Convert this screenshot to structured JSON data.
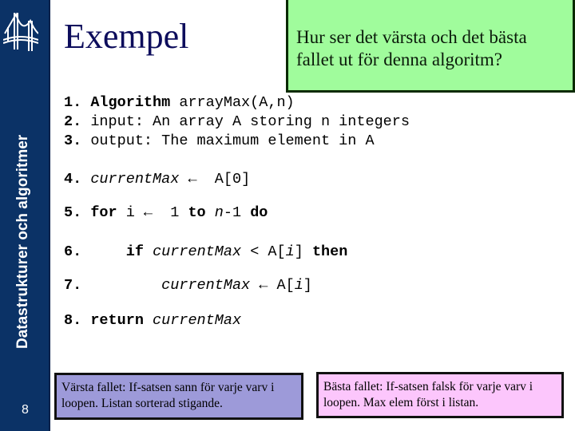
{
  "sidebar": {
    "course_title": "Datastrukturer och algoritmer",
    "logo_icon": "bridge-logo-icon",
    "slide_number": "8",
    "color": "#0b3266"
  },
  "slide": {
    "title": "Exempel",
    "question": "Hur ser det värsta och det bästa fallet ut för denna algoritm?",
    "question_box_color": "#a0fc9c"
  },
  "code": {
    "lines": [
      {
        "num": "1.",
        "parts": [
          {
            "t": "Algorithm",
            "s": "kw"
          },
          {
            "t": " arrayMax(A,n)",
            "s": ""
          }
        ]
      },
      {
        "num": "2.",
        "parts": [
          {
            "t": "input: An array A storing n integers",
            "s": ""
          }
        ]
      },
      {
        "num": "3.",
        "parts": [
          {
            "t": "output: The maximum element in A",
            "s": ""
          }
        ]
      },
      {
        "num": "4.",
        "parts": [
          {
            "t": "currentMax",
            "s": "it"
          },
          {
            "t": " ← ",
            "s": ""
          },
          {
            "t": " A[0]",
            "s": ""
          }
        ]
      },
      {
        "num": "5.",
        "parts": [
          {
            "t": "for",
            "s": "kw"
          },
          {
            "t": " i ← ",
            "s": ""
          },
          {
            "t": " 1 ",
            "s": ""
          },
          {
            "t": "to",
            "s": "kw"
          },
          {
            "t": " ",
            "s": ""
          },
          {
            "t": "n",
            "s": "it"
          },
          {
            "t": "-1 ",
            "s": ""
          },
          {
            "t": "do",
            "s": "kw"
          }
        ]
      },
      {
        "num": "6.",
        "parts": [
          {
            "t": "    ",
            "s": ""
          },
          {
            "t": "if",
            "s": "kw"
          },
          {
            "t": " ",
            "s": ""
          },
          {
            "t": "currentMax",
            "s": "it"
          },
          {
            "t": " < A[",
            "s": ""
          },
          {
            "t": "i",
            "s": "it"
          },
          {
            "t": "] ",
            "s": ""
          },
          {
            "t": "then",
            "s": "kw"
          }
        ]
      },
      {
        "num": "7.",
        "parts": [
          {
            "t": "        ",
            "s": ""
          },
          {
            "t": "currentMax",
            "s": "it"
          },
          {
            "t": " ← A[",
            "s": ""
          },
          {
            "t": "i",
            "s": "it"
          },
          {
            "t": "]",
            "s": ""
          }
        ]
      },
      {
        "num": "8.",
        "parts": [
          {
            "t": "return",
            "s": "kw"
          },
          {
            "t": " ",
            "s": ""
          },
          {
            "t": "currentMax",
            "s": "it"
          }
        ]
      }
    ]
  },
  "notes": {
    "worst_case": "Värsta fallet: If-satsen sann för varje varv i loopen. Listan sorterad stigande.",
    "worst_case_color": "#9d9ad9",
    "best_case": "Bästa fallet: If-satsen falsk för varje varv i loopen. Max elem först i listan.",
    "best_case_color": "#fcc6fc"
  }
}
